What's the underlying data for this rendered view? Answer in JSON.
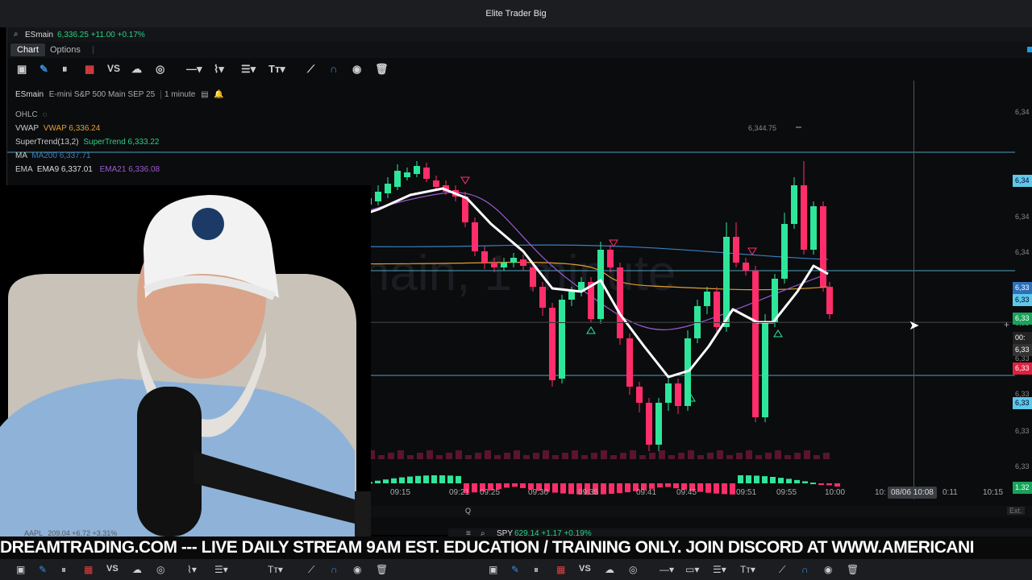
{
  "window": {
    "title": "Elite Trader Big"
  },
  "symbol_bar": {
    "symbol": "ESmain",
    "price": "6,336.25 +11.00 +0.17%"
  },
  "tabs": [
    {
      "label": "Chart"
    },
    {
      "label": "Options"
    }
  ],
  "chart_header": {
    "symbol": "ESmain",
    "description": "E-mini S&P 500 Main SEP 25",
    "interval": "1 minute"
  },
  "indicators": {
    "ohlc": "OHLC",
    "vwap": {
      "name": "VWAP",
      "value": "VWAP 6,336.24"
    },
    "supertrend": {
      "name": "SuperTrend(13,2)",
      "value": "SuperTrend 6,333.22"
    },
    "ma": {
      "name": "MA",
      "value": "MA200 6,337.71"
    },
    "ema": {
      "name": "EMA",
      "ema9": "EMA9 6,337.01",
      "ema21": "EMA21 6,336.08"
    }
  },
  "watermark": "ESmain, 1 minute",
  "high_label": "6,344.75",
  "price_axis": [
    "6,34",
    "6,34",
    "6,34",
    "6,34",
    "6,33",
    "6,33",
    "6,33",
    "6,33",
    "6,33",
    "6,33",
    "6,33",
    "6,32",
    "1.32"
  ],
  "price_tags": [
    {
      "label": "6,34",
      "color": "#5ec8e8"
    },
    {
      "label": "6,33",
      "color": "#2d6fb8"
    },
    {
      "label": "6,33",
      "color": "#5ec8e8"
    },
    {
      "label": "6,33",
      "color": "#17a35a"
    },
    {
      "label": "00:",
      "color": "#222"
    },
    {
      "label": "6,33",
      "color": "#333"
    },
    {
      "label": "6,33",
      "color": "#e02040"
    },
    {
      "label": "6,33",
      "color": "#5ec8e8"
    },
    {
      "label": "1.32",
      "color": "#17a35a"
    }
  ],
  "time_axis": [
    "09:15",
    "09:21",
    "09:25",
    "09:30",
    "09:35",
    "09:41",
    "09:45",
    "09:51",
    "09:55",
    "10:00",
    "10:",
    "0:11",
    "10:15"
  ],
  "cursor_time": "08/06 10:08",
  "lower_bar": {
    "left": "Q",
    "right": "Ext."
  },
  "spy": {
    "symbol": "SPY",
    "quote": "629.14 +1.17 +0.19%"
  },
  "aapl": {
    "symbol": "AAPL",
    "quote": "209.04 +6.72 +3.31%"
  },
  "ticker": "DREAMTRADING.COM --- LIVE DAILY STREAM 9AM EST. EDUCATION / TRAINING ONLY. JOIN DISCORD AT WWW.AMERICANI",
  "chart_data": {
    "type": "candlestick",
    "x": [
      "09:15",
      "09:21",
      "09:25",
      "09:30",
      "09:35",
      "09:41",
      "09:45",
      "09:51",
      "09:55",
      "10:00"
    ],
    "series": [
      {
        "name": "EMA9",
        "color": "#ffffff"
      },
      {
        "name": "EMA21",
        "color": "#9b59d0"
      },
      {
        "name": "VWAP",
        "color": "#e0a030"
      },
      {
        "name": "MA200",
        "color": "#3a7fc0"
      }
    ]
  }
}
